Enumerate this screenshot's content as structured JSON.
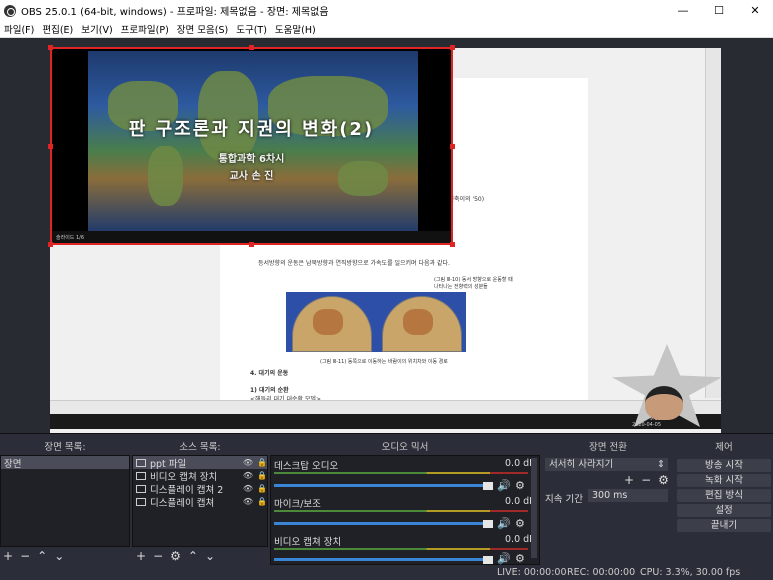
{
  "window": {
    "title": "OBS 25.0.1 (64-bit, windows) - 프로파일: 제목없음 - 장면: 제목없음",
    "min": "—",
    "max": "☐",
    "close": "✕"
  },
  "menu": [
    "파일(F)",
    "편집(E)",
    "보기(V)",
    "프로파일(P)",
    "장면 모음(S)",
    "도구(T)",
    "도움말(H)"
  ],
  "slide": {
    "title": "판  구조론과  지권의  변화(2)",
    "subtitle": "통합과학  6차시",
    "teacher": "교사  손  진",
    "bar_text": "슬라이드 1/6"
  },
  "doc": {
    "lines": [
      "지구 자전축이의 '50)",
      "등서방향의 운동은 남북방향과 연직방향으로 가속도를 일으키며 다음과 같다.",
      "(그림 Ⅲ-10) 동서 방향으로 운동할 때",
      "나타나는 전향력의 성분들",
      "(그림 Ⅲ-11) 동쪽으로 이동하는 바람이의 위치차와 이동 경로",
      "4. 대기의 운동",
      "1) 대기의 순환",
      "<해들리 대기 대순환 모델>"
    ]
  },
  "taskbar": {
    "time": "오후 9:38",
    "date": "2020-04-05"
  },
  "docks": {
    "scenes": {
      "header": "장면 목록:",
      "items": [
        "장면"
      ]
    },
    "sources": {
      "header": "소스 목록:",
      "items": [
        "ppt 파일",
        "비디오 캡쳐 장치",
        "디스플레이 캡쳐 2",
        "디스플레이 캡쳐"
      ]
    },
    "mixer": {
      "header": "오디오 믹서",
      "channels": [
        {
          "name": "데스크탑 오디오",
          "db": "0.0 dB"
        },
        {
          "name": "마이크/보조",
          "db": "0.0 dB"
        },
        {
          "name": "비디오 캡쳐 장치",
          "db": "0.0 dB"
        }
      ]
    },
    "transitions": {
      "header": "장면 전환",
      "type": "서서히 사라지기",
      "duration_label": "지속 기간",
      "duration": "300 ms"
    },
    "controls": {
      "header": "제어",
      "buttons": [
        "방송 시작",
        "녹화 시작",
        "편집 방식",
        "설정",
        "끝내기"
      ]
    }
  },
  "status": {
    "live": "LIVE: 00:00:00",
    "rec": "REC: 00:00:00",
    "cpu": "CPU: 3.3%, 30.00 fps"
  }
}
